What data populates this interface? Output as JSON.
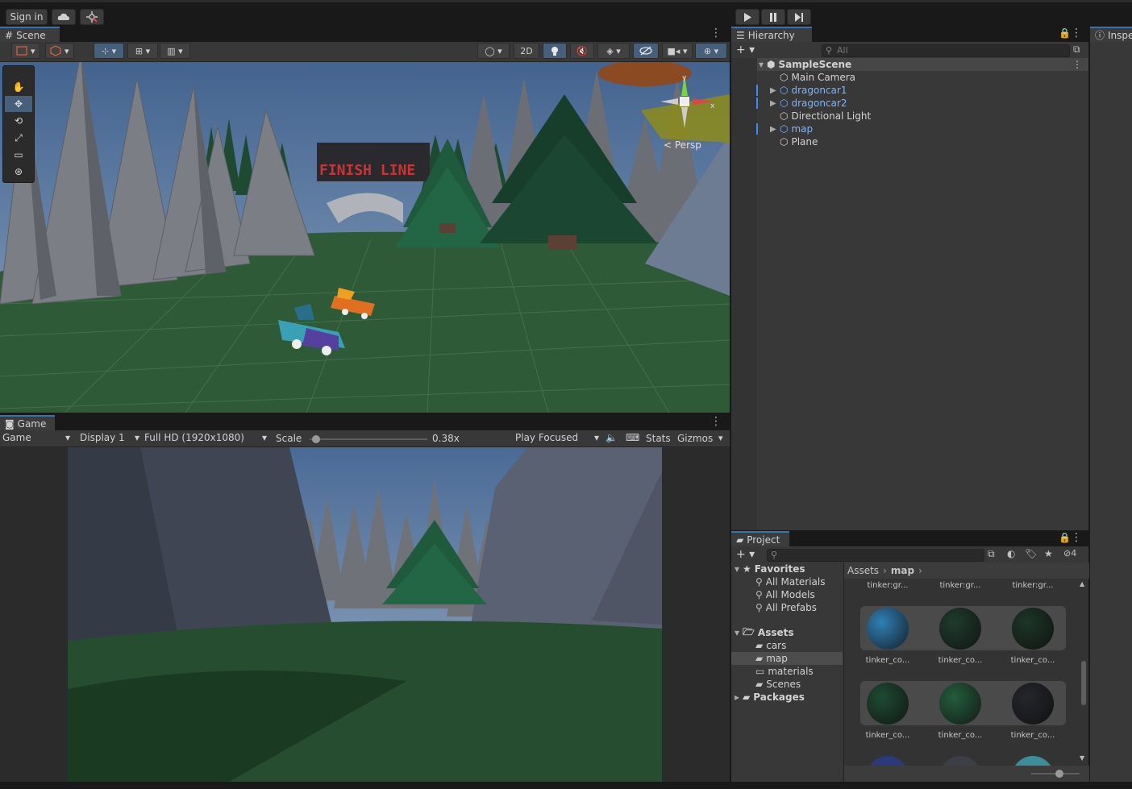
{
  "topbar": {
    "sign_in": "Sign in",
    "cloud_icon": "cloud-icon",
    "collab_icon": "collab-icon",
    "play_icon": "play-icon",
    "pause_icon": "pause-icon",
    "step_icon": "step-icon"
  },
  "scene": {
    "tab_label": "Scene",
    "toolbar": {
      "two_d": "2D",
      "persp_label": "Persp"
    },
    "gizmo_axes": {
      "x": "x",
      "y": "y"
    },
    "finish_text": "FINISH LINE"
  },
  "game": {
    "tab_label": "Game",
    "view_select": "Game",
    "display_select": "Display 1",
    "resolution_select": "Full HD (1920x1080)",
    "scale_label": "Scale",
    "scale_value": "0.38x",
    "scale_fraction": 0.02,
    "play_mode": "Play Focused",
    "stats": "Stats",
    "gizmos": "Gizmos"
  },
  "hierarchy": {
    "tab_label": "Hierarchy",
    "search_placeholder": "All",
    "scene_name": "SampleScene",
    "items": [
      {
        "label": "Main Camera",
        "prefab": false,
        "expandable": false
      },
      {
        "label": "dragoncar1",
        "prefab": true,
        "expandable": true
      },
      {
        "label": "dragoncar2",
        "prefab": true,
        "expandable": true
      },
      {
        "label": "Directional Light",
        "prefab": false,
        "expandable": false
      },
      {
        "label": "map",
        "prefab": true,
        "expandable": true
      },
      {
        "label": "Plane",
        "prefab": false,
        "expandable": false
      }
    ]
  },
  "inspector": {
    "tab_label": "Inspe"
  },
  "project": {
    "tab_label": "Project",
    "hidden_count": "4",
    "favorites_label": "Favorites",
    "favorites": [
      "All Materials",
      "All Models",
      "All Prefabs"
    ],
    "assets_label": "Assets",
    "folders": [
      "cars",
      "map",
      "materials",
      "Scenes"
    ],
    "packages_label": "Packages",
    "breadcrumb": [
      "Assets",
      "map"
    ],
    "top_row_labels": [
      "tinker:gr...",
      "tinker:gr...",
      "tinker:gr..."
    ],
    "grid": [
      {
        "caption": "tinker_co...",
        "color": "#2f7fb5"
      },
      {
        "caption": "tinker_co...",
        "color": "#1f3b2c"
      },
      {
        "caption": "tinker_co...",
        "color": "#1d3527"
      },
      {
        "caption": "tinker_co...",
        "color": "#1f4a32"
      },
      {
        "caption": "tinker_co...",
        "color": "#245c3c"
      },
      {
        "caption": "tinker_co...",
        "color": "#24262b"
      }
    ]
  }
}
